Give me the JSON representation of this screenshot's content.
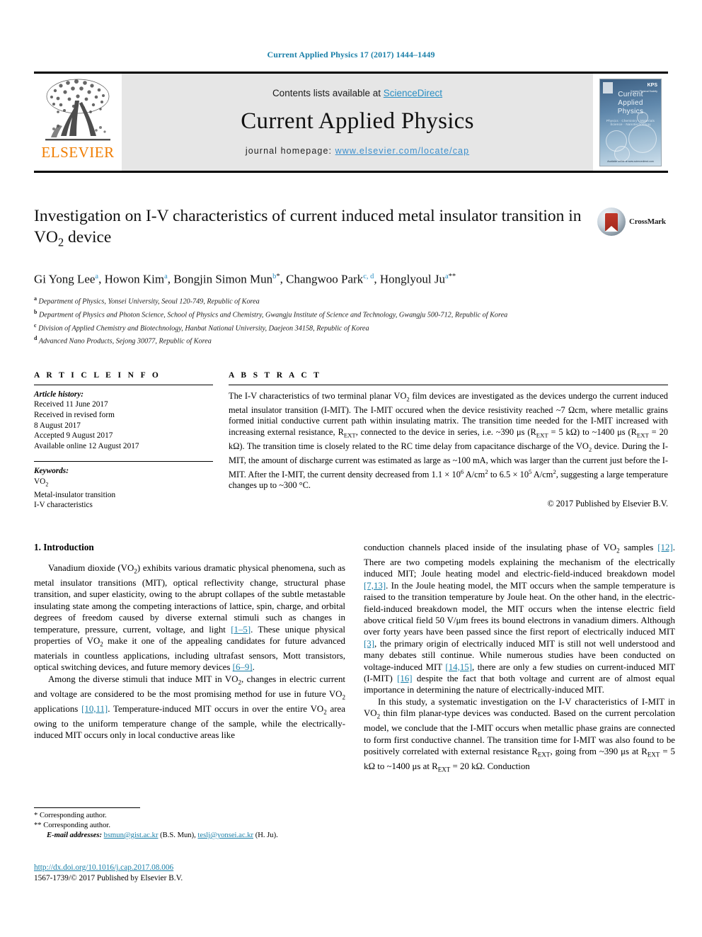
{
  "running_head": "Current Applied Physics 17 (2017) 1444–1449",
  "masthead": {
    "contents_prefix": "Contents lists available at ",
    "contents_link": "ScienceDirect",
    "journal_title": "Current Applied Physics",
    "homepage_prefix": "journal homepage: ",
    "homepage_url": "www.elsevier.com/locate/cap",
    "publisher": "ELSEVIER",
    "cover": {
      "line1": "Current",
      "line2": "Applied",
      "line3": "Physics",
      "subtitle": "Physics · Chemistry · Materials Science · Nanotechnology",
      "society": "KPS",
      "society_sub": "Korean Physical Society",
      "footer": "Available online at www.sciencedirect.com"
    }
  },
  "article": {
    "title": "Investigation on I-V characteristics of current induced metal insulator transition in VO2 device",
    "title_part1": "Investigation on I-V characteristics of current induced metal insulator transition in VO",
    "title_sub": "2",
    "title_part2": " device",
    "crossmark_label": "CrossMark",
    "authors": [
      {
        "name": "Gi Yong Lee",
        "marks": "a"
      },
      {
        "name": "Howon Kim",
        "marks": "a"
      },
      {
        "name": "Bongjin Simon Mun",
        "marks": "b",
        "star": "*"
      },
      {
        "name": "Changwoo Park",
        "marks": "c, d"
      },
      {
        "name": "Honglyoul Ju",
        "marks": "a",
        "star": "**"
      }
    ],
    "affiliations": [
      {
        "label": "a",
        "text": "Department of Physics, Yonsei University, Seoul 120-749, Republic of Korea"
      },
      {
        "label": "b",
        "text": "Department of Physics and Photon Science, School of Physics and Chemistry, Gwangju Institute of Science and Technology, Gwangju 500-712, Republic of Korea"
      },
      {
        "label": "c",
        "text": "Division of Applied Chemistry and Biotechnology, Hanbat National University, Daejeon 34158, Republic of Korea"
      },
      {
        "label": "d",
        "text": "Advanced Nano Products, Sejong 30077, Republic of Korea"
      }
    ]
  },
  "article_info": {
    "heading": "A R T I C L E   I N F O",
    "history_label": "Article history:",
    "history_lines": [
      "Received 11 June 2017",
      "Received in revised form",
      "8 August 2017",
      "Accepted 9 August 2017",
      "Available online 12 August 2017"
    ],
    "keywords_label": "Keywords:",
    "keywords": [
      "VO2",
      "Metal-insulator transition",
      "I-V characteristics"
    ]
  },
  "abstract": {
    "heading": "A B S T R A C T",
    "text": "The I-V characteristics of two terminal planar VO2 film devices are investigated as the devices undergo the current induced metal insulator transition (I-MIT). The I-MIT occured when the device resistivity reached ~7 Ωcm, where metallic grains formed initial conductive current path within insulating matrix. The transition time needed for the I-MIT increased with increasing external resistance, REXT, connected to the device in series, i.e. ~390 μs (REXT = 5 kΩ) to ~1400 μs (REXT = 20 kΩ). The transition time is closely related to the RC time delay from capacitance discharge of the VO2 device. During the I-MIT, the amount of discharge current was estimated as large as ~100 mA, which was larger than the current just before the I-MIT. After the I-MIT, the current density decreased from 1.1 × 10^6 A/cm2 to 6.5 × 10^5 A/cm2, suggesting a large temperature changes up to ~300 °C.",
    "copyright": "© 2017 Published by Elsevier B.V."
  },
  "sections": {
    "intro_heading": "1.  Introduction",
    "left_paragraphs": [
      "Vanadium dioxide (VO2) exhibits various dramatic physical phenomena, such as metal insulator transitions (MIT), optical reflectivity change, structural phase transition, and super elasticity, owing to the abrupt collapes of the subtle metastable insulating state among the competing interactions of lattice, spin, charge, and orbital degrees of freedom caused by diverse external stimuli such as changes in temperature, pressure, current, voltage, and light [1–5]. These unique physical properties of VO2 make it one of the appealing candidates for future advanced materials in countless applications, including ultrafast sensors, Mott transistors, optical switching devices, and future memory devices [6–9].",
      "Among the diverse stimuli that induce MIT in VO2, changes in electric current and voltage are considered to be the most promising method for use in future VO2 applications [10,11]. Temperature-induced MIT occurs in over the entire VO2 area owing to the uniform temperature change of the sample, while the electrically-induced MIT occurs only in local conductive areas like"
    ],
    "right_paragraphs": [
      "conduction channels placed inside of the insulating phase of VO2 samples [12]. There are two competing models explaining the mechanism of the electrically induced MIT; Joule heating model and electric-field-induced breakdown model [7,13]. In the Joule heating model, the MIT occurs when the sample temperature is raised to the transition temperature by Joule heat. On the other hand, in the electric-field-induced breakdown model, the MIT occurs when the intense electric field above critical field 50 V/μm frees its bound electrons in vanadium dimers. Although over forty years have been passed since the first report of electrically induced MIT [3], the primary origin of electrically induced MIT is still not well understood and many debates still continue. While numerous studies have been conducted on voltage-induced MIT [14,15], there are only a few studies on current-induced MIT (I-MIT) [16] despite the fact that both voltage and current are of almost equal importance in determining the nature of electrically-induced MIT.",
      "In this study, a systematic investigation on the I-V characteristics of I-MIT in VO2 thin film planar-type devices was conducted. Based on the current percolation model, we conclude that the I-MIT occurs when metallic phase grains are connected to form first conductive channel. The transition time for I-MIT was also found to be positively correlated with external resistance REXT, going from ~390 μs at REXT = 5 kΩ to ~1400 μs at REXT = 20 kΩ. Conduction"
    ]
  },
  "footnotes": {
    "line1_mark": "*",
    "line1": "Corresponding author.",
    "line2_mark": "**",
    "line2": "Corresponding author.",
    "email_label": "E-mail addresses:",
    "email1": "bsmun@gist.ac.kr",
    "email1_who": "(B.S. Mun),",
    "email2": "teslj@yonsei.ac.kr",
    "email2_who": "(H. Ju).",
    "doi": "http://dx.doi.org/10.1016/j.cap.2017.08.006",
    "issn_line": "1567-1739/© 2017 Published by Elsevier B.V."
  },
  "colors": {
    "link": "#1a7fa8",
    "sciencedirect": "#2a8fc4",
    "elsevier_orange": "#f07d00",
    "masthead_bg": "#e6e6e6"
  }
}
